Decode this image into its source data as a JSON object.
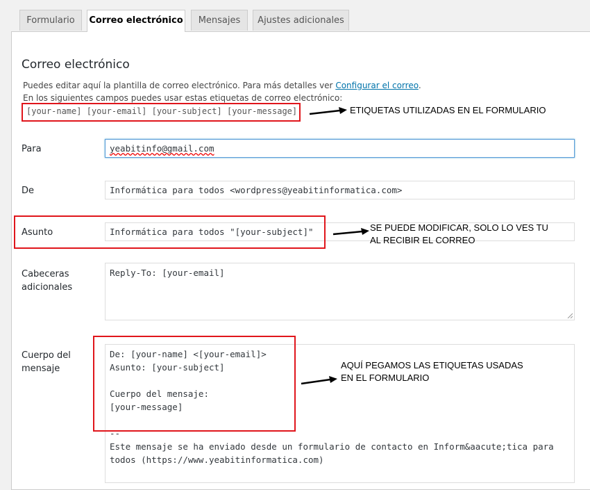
{
  "tabs": [
    {
      "label": "Formulario"
    },
    {
      "label": "Correo electrónico",
      "active": true
    },
    {
      "label": "Mensajes"
    },
    {
      "label": "Ajustes adicionales"
    }
  ],
  "section": {
    "title": "Correo electrónico",
    "desc1_prefix": "Puedes editar aquí la plantilla de correo electrónico. Para más detalles ver ",
    "desc1_link": "Configurar el correo",
    "desc1_suffix": ".",
    "desc2": "En los siguientes campos puedes usar estas etiquetas de correo electrónico:",
    "tags": "[your-name] [your-email] [your-subject] [your-message]"
  },
  "fields": {
    "para": {
      "label": "Para",
      "value": "yeabitinfo@gmail.com"
    },
    "de": {
      "label": "De",
      "value": "Informática para todos <wordpress@yeabitinformatica.com>"
    },
    "asunto": {
      "label": "Asunto",
      "value": "Informática para todos \"[your-subject]\""
    },
    "cabeceras": {
      "label_line1": "Cabeceras",
      "label_line2": "adicionales",
      "value": "Reply-To: [your-email]"
    },
    "cuerpo": {
      "label_line1": "Cuerpo del",
      "label_line2": "mensaje",
      "lines": [
        "De: [your-name] <[your-email]>",
        "Asunto: [your-subject]",
        "",
        "Cuerpo del mensaje:",
        "[your-message]",
        "",
        "--",
        "Este mensaje se ha enviado desde un formulario de contacto en Inform&aacute;tica para",
        "todos (https://www.yeabitinformatica.com)"
      ]
    }
  },
  "annotations": {
    "tags_note": "ETIQUETAS UTILIZADAS EN EL FORMULARIO",
    "asunto_note_line1": "SE PUEDE MODIFICAR, SOLO LO VES TU",
    "asunto_note_line2": "AL RECIBIR EL CORREO",
    "cuerpo_note_line1": "AQUÍ PEGAMOS LAS ETIQUETAS USADAS",
    "cuerpo_note_line2": "EN EL FORMULARIO"
  },
  "colors": {
    "link": "#0073aa",
    "annotation_box": "#e0151b",
    "focus_border": "#5b9dd9"
  }
}
